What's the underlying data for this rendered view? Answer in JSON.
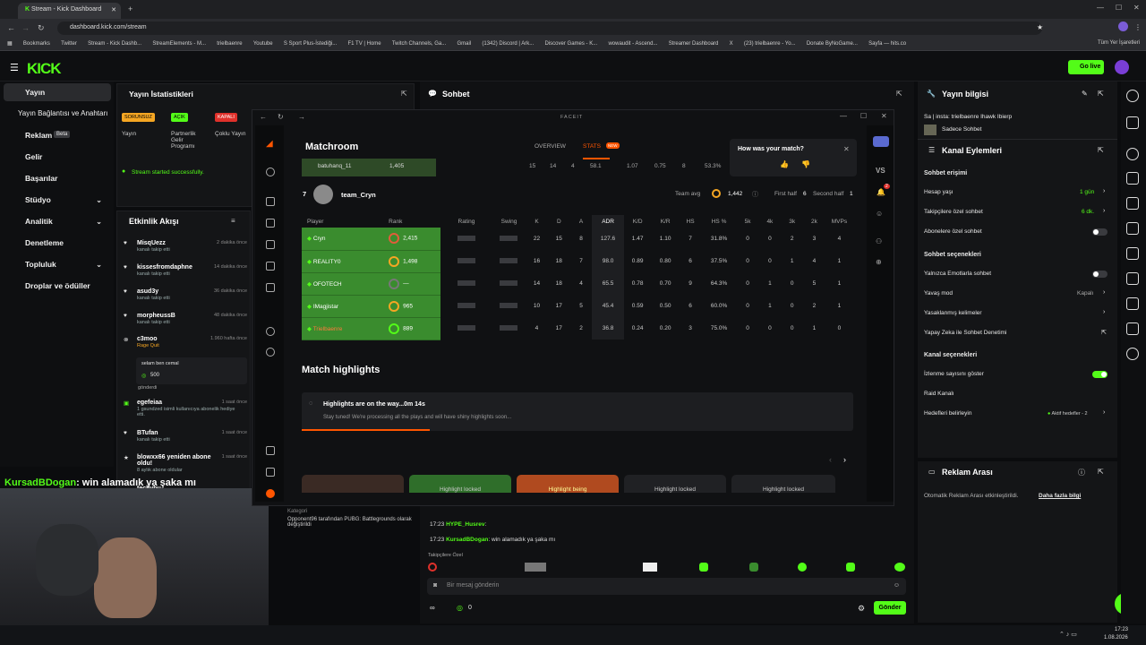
{
  "browser": {
    "tab_title": "Stream - Kick Dashboard",
    "url": "dashboard.kick.com/stream",
    "bookmarks": [
      "Bookmarks",
      "Twitter",
      "Stream - Kick Dashb...",
      "StreamElements - M...",
      "trielbaenre",
      "Youtube",
      "S Sport Plus-İstediği...",
      "F1 TV | Home",
      "Twitch Channels, Ga...",
      "Gmail",
      "(1342) Discord | Ark...",
      "Discover Games - K...",
      "wowaudit - Ascend...",
      "Streamer Dashboard",
      "X",
      "(23) trielbaenre - Yo...",
      "Donate ByNoGame...",
      "Sayfa — hits.co"
    ],
    "all_bookmarks": "Tüm Yer İşaretleri"
  },
  "kick": {
    "logo": "KICK",
    "go_live": "Go live"
  },
  "sidebar": {
    "items": [
      "Yayın",
      "Yayın Bağlantısı ve Anahtarı",
      "Reklam",
      "Gelir",
      "Başarılar",
      "Stüdyo",
      "Analitik",
      "Denetleme",
      "Topluluk",
      "Droplar ve ödüller"
    ],
    "beta": "Beta"
  },
  "stats_panel": {
    "title": "Yayın İstatistikleri",
    "badges": [
      "SORUNSUZ",
      "AÇIK",
      "KAPALI"
    ],
    "labels": [
      "Yayın",
      "Partnerlik Gelir Programı",
      "Çoklu Yayın"
    ],
    "status": "Stream started successfully."
  },
  "activity": {
    "title": "Etkinlik Akışı",
    "items": [
      {
        "user": "MisqUezz",
        "action": "kanalı takip etti",
        "time": "2 dakika önce"
      },
      {
        "user": "kissesfromdaphne",
        "action": "kanalı takip etti",
        "time": "14 dakika önce"
      },
      {
        "user": "asud3y",
        "action": "kanalı takip etti",
        "time": "36 dakika önce"
      },
      {
        "user": "morpheussB",
        "action": "kanalı takip etti",
        "time": "48 dakika önce"
      },
      {
        "user": "c3moo",
        "action": "Rage Quit",
        "time": "1.960 hafta önce"
      },
      {
        "user": "egefeiaa",
        "action": "1 gsundzed isimli kullanıcıya abonelik hediye etti.",
        "time": "1 saat önce"
      },
      {
        "user": "BTufan",
        "action": "kanalı takip etti",
        "time": "1 saat önce"
      },
      {
        "user": "blowxx66 yeniden abone oldu!",
        "action": "8 aylık abone oldular",
        "time": "1 saat önce"
      },
      {
        "user": "techybu",
        "action": "",
        "time": ""
      }
    ],
    "c3moo_msg": "selam ben cemal",
    "c3moo_amount": "500",
    "c3moo_sent": "gönderdi"
  },
  "overlay_chat": {
    "user": "KursadBDogan",
    "message": ": win alamadık ya şaka mı"
  },
  "faceit": {
    "app_title": "FACEIT",
    "page": "Matchroom",
    "nav": [
      "OVERVIEW",
      "STATS"
    ],
    "new_badge": "NEW",
    "prev_row": {
      "name": "batuhanq_11",
      "elo": "1,405",
      "k": "15",
      "d": "14",
      "a": "4",
      "adr": "58.1",
      "kd": "1.07",
      "kr": "0.75",
      "hs": "8",
      "hsp": "53.3%"
    },
    "team_number": "7",
    "team_name": "team_Cryn",
    "team_avg_label": "Team avg",
    "team_avg": "1,442",
    "first_half_label": "First half",
    "first_half": "6",
    "second_half_label": "Second half",
    "second_half": "1",
    "columns": [
      "Player",
      "Rank",
      "Rating",
      "Swing",
      "K",
      "D",
      "A",
      "ADR",
      "K/D",
      "K/R",
      "HS",
      "HS %",
      "5k",
      "4k",
      "3k",
      "2k",
      "MVPs"
    ],
    "players": [
      {
        "name": "Cryn",
        "rank": "2,415",
        "k": "22",
        "d": "15",
        "a": "8",
        "adr": "127.6",
        "kd": "1.47",
        "kr": "1.10",
        "hs": "7",
        "hsp": "31.8%",
        "k5": "0",
        "k4": "0",
        "k3": "2",
        "k2": "3",
        "mvps": "4"
      },
      {
        "name": "REALITY0",
        "rank": "1,498",
        "k": "16",
        "d": "18",
        "a": "7",
        "adr": "98.0",
        "kd": "0.89",
        "kr": "0.80",
        "hs": "6",
        "hsp": "37.5%",
        "k5": "0",
        "k4": "0",
        "k3": "1",
        "k2": "4",
        "mvps": "1"
      },
      {
        "name": "OFOTECH",
        "rank": "—",
        "k": "14",
        "d": "18",
        "a": "4",
        "adr": "65.5",
        "kd": "0.78",
        "kr": "0.70",
        "hs": "9",
        "hsp": "64.3%",
        "k5": "0",
        "k4": "1",
        "k3": "0",
        "k2": "5",
        "mvps": "1"
      },
      {
        "name": "IMagjistar",
        "rank": "965",
        "k": "10",
        "d": "17",
        "a": "5",
        "adr": "45.4",
        "kd": "0.59",
        "kr": "0.50",
        "hs": "6",
        "hsp": "60.0%",
        "k5": "0",
        "k4": "1",
        "k3": "0",
        "k2": "2",
        "mvps": "1"
      },
      {
        "name": "Trielbaenre",
        "rank": "889",
        "k": "4",
        "d": "17",
        "a": "2",
        "adr": "36.8",
        "kd": "0.24",
        "kr": "0.20",
        "hs": "3",
        "hsp": "75.0%",
        "k5": "0",
        "k4": "0",
        "k3": "0",
        "k2": "1",
        "mvps": "0"
      }
    ],
    "highlights_title": "Match highlights",
    "highlights_status": "Highlights are on the way...0m 14s",
    "highlights_sub": "Stay tuned! We're processing all the plays and will have shiny highlights soon...",
    "highlight_cards": [
      "",
      "Highlight locked",
      "Highlight being",
      "Highlight locked",
      "Highlight locked"
    ],
    "feedback_q": "How was your match?",
    "vs": "VS",
    "notif_count": "2"
  },
  "chat": {
    "title": "Sohbet",
    "messages": [
      {
        "time": "17:23",
        "user": "HYPE_Husrev",
        "text": ":"
      },
      {
        "time": "17:23",
        "user": "KursadBDogan",
        "text": ": win alamadık ya şaka mı"
      }
    ],
    "category_label": "Kategori",
    "category_change": "Opponent96 tarafından PUBG: Battlegrounds olarak değiştirildi",
    "followers_only": "Takipçilere Özel",
    "input_placeholder": "Bir mesaj gönderin",
    "send": "Gönder",
    "viewer_count": "0"
  },
  "stream_info": {
    "title": "Yayın bilgisi",
    "line": "Sa | insta: trielbaenre Ihawk Ibierp",
    "category": "Sadece Sohbet"
  },
  "channel_actions": {
    "title": "Kanal Eylemleri",
    "chat_access": "Sohbet erişimi",
    "account_age": "Hesap yaşı",
    "account_age_val": "1 gün",
    "follower_chat": "Takipçilere özel sohbet",
    "follower_chat_val": "6 dk.",
    "sub_chat": "Abonelere özel sohbet",
    "chat_options": "Sohbet seçenekleri",
    "emote_only": "Yalnızca Emotlarla sohbet",
    "slow_mode": "Yavaş mod",
    "slow_mode_val": "Kapalı",
    "banned_words": "Yasaklanmış kelimeler",
    "ai_mod": "Yapay Zeka ile Sohbet Denetimi",
    "channel_options": "Kanal seçenekleri",
    "show_viewers": "İzlenme sayısını göster",
    "raid": "Raid Kanalı",
    "goals": "Hedefleri belirleyin",
    "goals_val": "Aktif hedefler - 2"
  },
  "ad_break": {
    "title": "Reklam Arası",
    "text": "Otomatik Reklam Arası etkinleştirildi.",
    "link": "Daha fazla bilgi"
  },
  "taskbar": {
    "time": "17:23",
    "date": "1.08.2026"
  }
}
